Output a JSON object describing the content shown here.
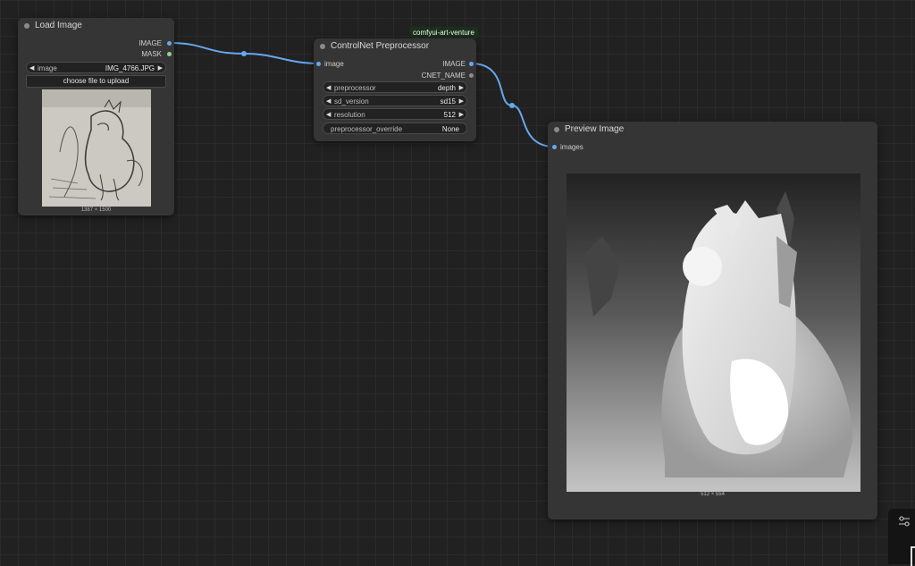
{
  "badge": {
    "text": "comfyui-art-venture"
  },
  "load_image": {
    "title": "Load Image",
    "outputs": {
      "image": "IMAGE",
      "mask": "MASK"
    },
    "image_widget": {
      "label": "image",
      "value": "IMG_4766.JPG"
    },
    "upload_button": "choose file to upload",
    "dimensions": "1387 × 1500"
  },
  "preprocessor": {
    "title": "ControlNet Preprocessor",
    "inputs": {
      "image": "image"
    },
    "outputs": {
      "image": "IMAGE",
      "cnet_name": "CNET_NAME"
    },
    "widgets": [
      {
        "label": "preprocessor",
        "value": "depth"
      },
      {
        "label": "sd_version",
        "value": "sd15"
      },
      {
        "label": "resolution",
        "value": "512"
      }
    ],
    "override": {
      "label": "preprocessor_override",
      "value": "None"
    }
  },
  "preview": {
    "title": "Preview Image",
    "inputs": {
      "images": "images"
    },
    "dimensions": "512 × 554"
  },
  "colors": {
    "link": "#64a8f0",
    "node_bg": "#353535",
    "canvas_bg": "#212121",
    "mask_slot": "#8fd48a"
  }
}
